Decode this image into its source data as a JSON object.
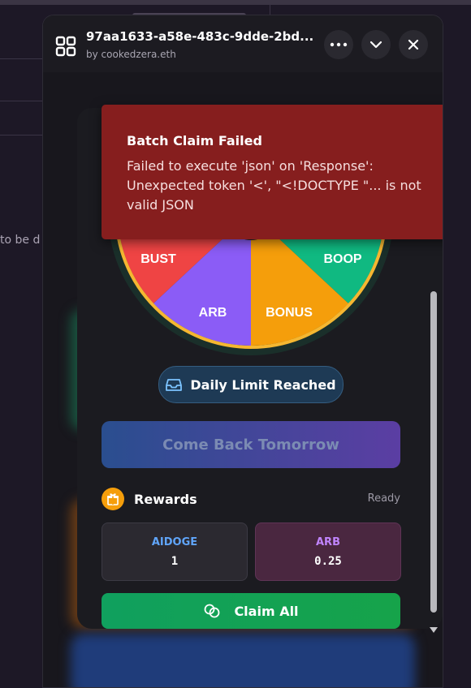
{
  "background": {
    "partial_text": "to be d"
  },
  "window": {
    "title": "97aa1633-a58e-483c-9dde-2bd...",
    "author": "by cookedzera.eth",
    "menu_icon": "more-horizontal-icon",
    "collapse_icon": "chevron-down-icon",
    "close_icon": "close-icon"
  },
  "wheel": {
    "segments": [
      {
        "label": "BUST",
        "color": "#ef4444"
      },
      {
        "label": "BOOP",
        "color": "#10b981"
      },
      {
        "label": "ARB",
        "color": "#8b5cf6"
      },
      {
        "label": "BONUS",
        "color": "#f59e0b"
      }
    ],
    "rim_color": "#f5b731"
  },
  "status_pill": {
    "label": "Daily Limit Reached",
    "icon": "inbox-icon"
  },
  "spin_button": {
    "label": "Come Back Tomorrow"
  },
  "rewards": {
    "title": "Rewards",
    "status": "Ready",
    "icon": "gift-icon",
    "tokens": [
      {
        "name": "AIDOGE",
        "value": "1",
        "color": "#60a5fa"
      },
      {
        "name": "ARB",
        "value": "0.25",
        "color": "#c084fc"
      }
    ]
  },
  "claim_button": {
    "label": "Claim All",
    "icon": "coins-icon"
  },
  "toast": {
    "title": "Batch Claim Failed",
    "message": "Failed to execute 'json' on 'Response': Unexpected token '<', \"<!DOCTYPE \"... is not valid JSON"
  }
}
